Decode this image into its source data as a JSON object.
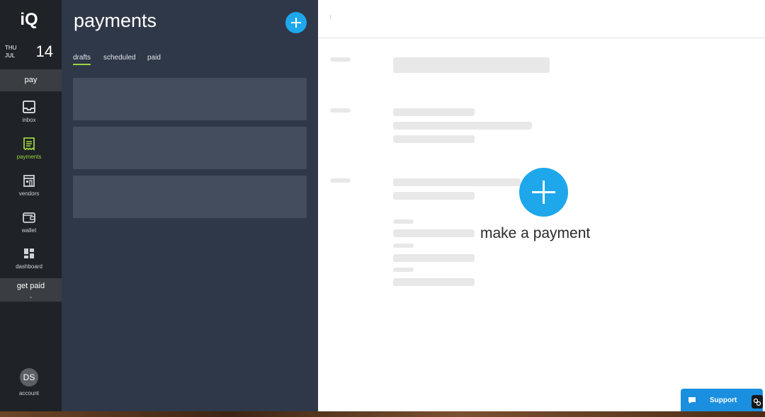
{
  "brand": {
    "logo_text": "iQ"
  },
  "date": {
    "weekday": "THU",
    "month": "JUL",
    "day": "14"
  },
  "rail": {
    "section_pay": "pay",
    "items": [
      {
        "label": "inbox",
        "icon": "inbox-icon"
      },
      {
        "label": "payments",
        "icon": "receipt-icon"
      },
      {
        "label": "vendors",
        "icon": "storefront-icon"
      },
      {
        "label": "wallet",
        "icon": "wallet-icon"
      },
      {
        "label": "dashboard",
        "icon": "dashboard-icon"
      }
    ],
    "section_get_paid": "get paid",
    "active_item": "payments",
    "account": {
      "initials": "DS",
      "label": "account"
    }
  },
  "list_pane": {
    "title": "payments",
    "tabs": [
      {
        "label": "drafts"
      },
      {
        "label": "scheduled"
      },
      {
        "label": "paid"
      }
    ],
    "active_tab": "drafts"
  },
  "detail": {
    "cta_label": "make a payment"
  },
  "support": {
    "label": "Support"
  },
  "colors": {
    "accent_blue": "#1ea7ea",
    "accent_green": "#9bd33c",
    "rail_bg": "#1f2227",
    "pane_bg": "#2f3848"
  }
}
